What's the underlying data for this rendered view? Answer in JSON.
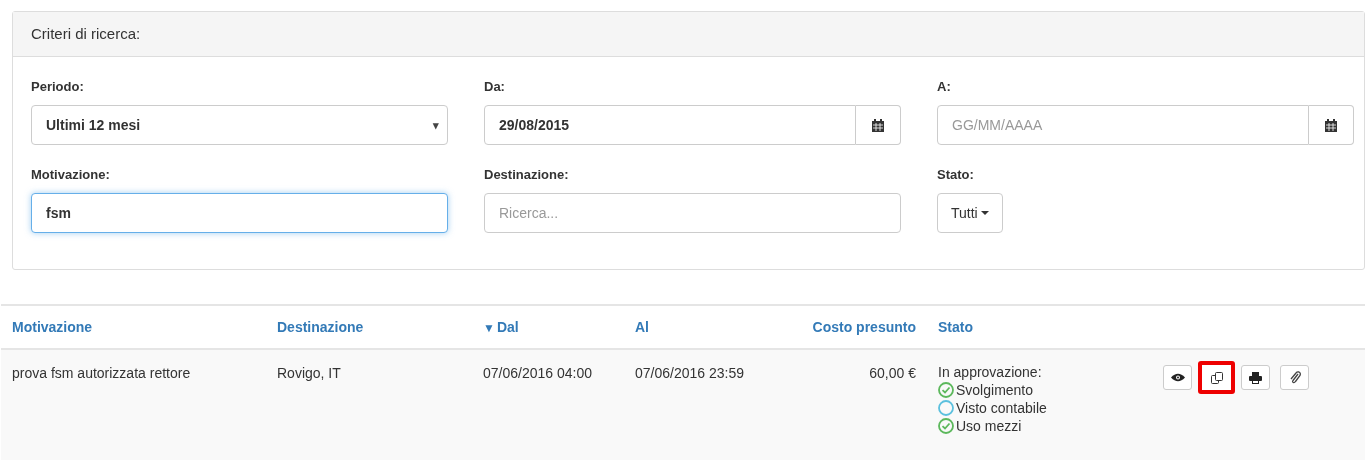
{
  "search_panel": {
    "title": "Criteri di ricerca:",
    "fields": [
      {
        "kind": "select",
        "label": "Periodo:",
        "value": "Ultimi 12 mesi",
        "caret": "▾",
        "focused": false
      },
      {
        "kind": "date",
        "label": "Da:",
        "value": "29/08/2015",
        "focused": false
      },
      {
        "kind": "date",
        "label": "A:",
        "placeholder": "GG/MM/AAAA",
        "focused": false
      },
      {
        "kind": "text",
        "label": "Motivazione:",
        "value": "fsm",
        "focused": true
      },
      {
        "kind": "text",
        "label": "Destinazione:",
        "placeholder": "Ricerca...",
        "focused": false
      },
      {
        "kind": "dropdown",
        "label": "Stato:",
        "value": "Tutti"
      }
    ]
  },
  "table": {
    "columns": [
      {
        "label": "Motivazione",
        "sorted": false
      },
      {
        "label": "Destinazione",
        "sorted": false
      },
      {
        "label": "Dal",
        "sorted": true,
        "sort_mark": "▼"
      },
      {
        "label": "Al",
        "sorted": false
      },
      {
        "label": "Costo presunto",
        "sorted": false
      },
      {
        "label": "Stato",
        "sorted": false
      }
    ],
    "rows": [
      {
        "motivazione": "prova fsm autorizzata rettore",
        "destinazione": "Rovigo, IT",
        "dal": "07/06/2016 04:00",
        "al": "07/06/2016 23:59",
        "costo": "60,00 €",
        "stato": "In approvazione:",
        "steps": [
          {
            "label": "Svolgimento",
            "done": true
          },
          {
            "label": "Visto contabile",
            "done": false
          },
          {
            "label": "Uso mezzi",
            "done": true
          }
        ],
        "actions": [
          {
            "kind": "view",
            "highlighted": false
          },
          {
            "kind": "copy",
            "highlighted": true
          },
          {
            "kind": "print",
            "highlighted": false
          },
          {
            "kind": "attach",
            "highlighted": false
          }
        ]
      }
    ]
  }
}
